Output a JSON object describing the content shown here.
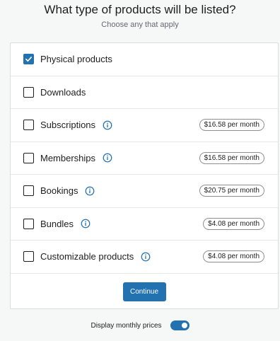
{
  "header": {
    "title": "What type of products will be listed?",
    "subtitle": "Choose any that apply"
  },
  "options": [
    {
      "label": "Physical products",
      "checked": true,
      "info": false,
      "price": ""
    },
    {
      "label": "Downloads",
      "checked": false,
      "info": false,
      "price": ""
    },
    {
      "label": "Subscriptions",
      "checked": false,
      "info": true,
      "price": "$16.58 per month"
    },
    {
      "label": "Memberships",
      "checked": false,
      "info": true,
      "price": "$16.58 per month"
    },
    {
      "label": "Bookings",
      "checked": false,
      "info": true,
      "price": "$20.75 per month"
    },
    {
      "label": "Bundles",
      "checked": false,
      "info": true,
      "price": "$4.08 per month"
    },
    {
      "label": "Customizable products",
      "checked": false,
      "info": true,
      "price": "$4.08 per month"
    }
  ],
  "footer": {
    "continue_label": "Continue"
  },
  "display_toggle": {
    "label": "Display monthly prices",
    "on": true
  },
  "colors": {
    "accent": "#2271b1",
    "background": "#f6f7f7"
  },
  "icons": {
    "check": "check-icon",
    "info": "info-icon"
  }
}
